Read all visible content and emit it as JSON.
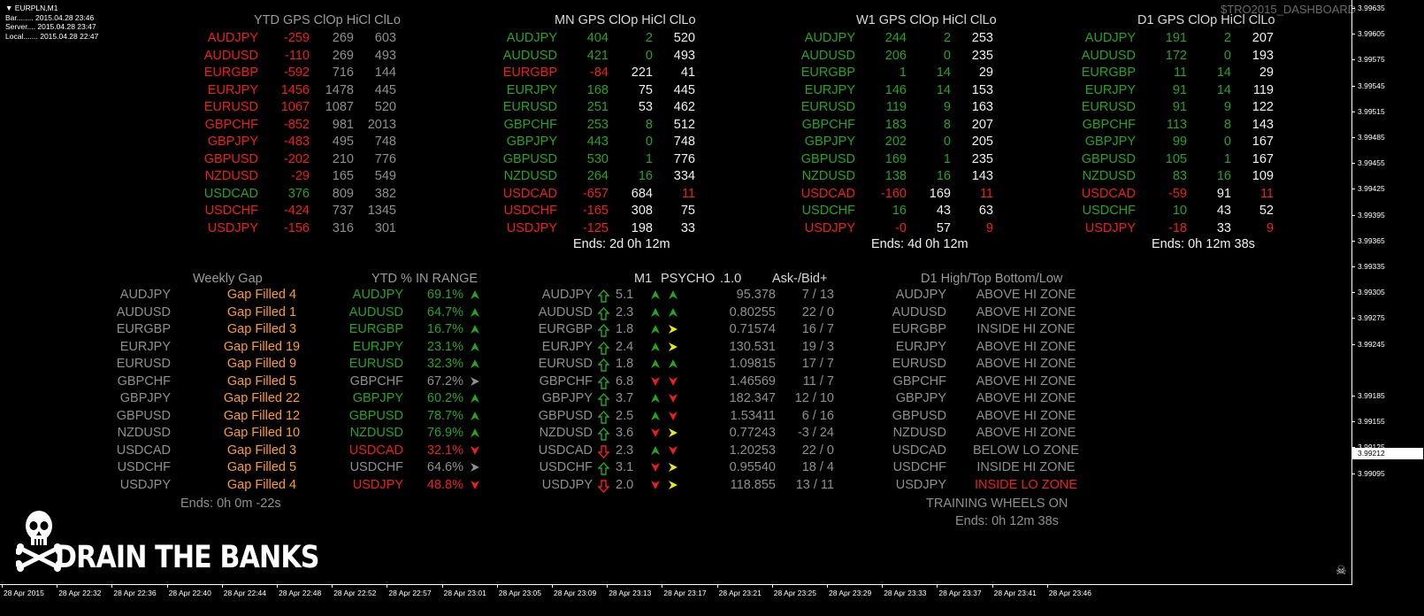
{
  "window": {
    "title": "EURPLN,M1",
    "bar_label": "Bar........ 2015.04.28 23:46",
    "server_label": "Server.... 2015.04.28 23:47",
    "local_label": "Local....... 2015.04.28 22:47",
    "watermark": "$TRO2015_DASHBOARD"
  },
  "gps_panels": [
    {
      "title": "YTD GPS ClOp HiCl ClLo",
      "ends": "",
      "rows": [
        {
          "sym": "AUDJPY",
          "sc": "r",
          "gps": "-259",
          "gc": "r",
          "a": "269",
          "ac": "gr",
          "b": "603",
          "bc": "gr"
        },
        {
          "sym": "AUDUSD",
          "sc": "r",
          "gps": "-110",
          "gc": "r",
          "a": "269",
          "ac": "gr",
          "b": "493",
          "bc": "gr"
        },
        {
          "sym": "EURGBP",
          "sc": "r",
          "gps": "-592",
          "gc": "r",
          "a": "716",
          "ac": "gr",
          "b": "144",
          "bc": "gr"
        },
        {
          "sym": "EURJPY",
          "sc": "r",
          "gps": "1456",
          "gc": "r",
          "a": "1478",
          "ac": "gr",
          "b": "445",
          "bc": "gr"
        },
        {
          "sym": "EURUSD",
          "sc": "r",
          "gps": "1067",
          "gc": "r",
          "a": "1087",
          "ac": "gr",
          "b": "520",
          "bc": "gr"
        },
        {
          "sym": "GBPCHF",
          "sc": "r",
          "gps": "-852",
          "gc": "r",
          "a": "981",
          "ac": "gr",
          "b": "2013",
          "bc": "gr"
        },
        {
          "sym": "GBPJPY",
          "sc": "r",
          "gps": "-483",
          "gc": "r",
          "a": "495",
          "ac": "gr",
          "b": "748",
          "bc": "gr"
        },
        {
          "sym": "GBPUSD",
          "sc": "r",
          "gps": "-202",
          "gc": "r",
          "a": "210",
          "ac": "gr",
          "b": "776",
          "bc": "gr"
        },
        {
          "sym": "NZDUSD",
          "sc": "r",
          "gps": "-29",
          "gc": "r",
          "a": "165",
          "ac": "gr",
          "b": "549",
          "bc": "gr"
        },
        {
          "sym": "USDCAD",
          "sc": "g",
          "gps": "376",
          "gc": "g",
          "a": "809",
          "ac": "gr",
          "b": "382",
          "bc": "gr"
        },
        {
          "sym": "USDCHF",
          "sc": "r",
          "gps": "-424",
          "gc": "r",
          "a": "737",
          "ac": "gr",
          "b": "1345",
          "bc": "gr"
        },
        {
          "sym": "USDJPY",
          "sc": "r",
          "gps": "-156",
          "gc": "r",
          "a": "316",
          "ac": "gr",
          "b": "301",
          "bc": "gr"
        }
      ]
    },
    {
      "title": "MN GPS  ClOp HiCl ClLo",
      "ends": "Ends: 2d 0h 12m",
      "rows": [
        {
          "sym": "AUDJPY",
          "sc": "g",
          "gps": "404",
          "gc": "g",
          "a": "2",
          "ac": "g",
          "b": "520",
          "bc": "w"
        },
        {
          "sym": "AUDUSD",
          "sc": "g",
          "gps": "421",
          "gc": "g",
          "a": "0",
          "ac": "g",
          "b": "493",
          "bc": "w"
        },
        {
          "sym": "EURGBP",
          "sc": "r",
          "gps": "-84",
          "gc": "r",
          "a": "221",
          "ac": "w",
          "b": "41",
          "bc": "w"
        },
        {
          "sym": "EURJPY",
          "sc": "g",
          "gps": "168",
          "gc": "g",
          "a": "75",
          "ac": "w",
          "b": "445",
          "bc": "w"
        },
        {
          "sym": "EURUSD",
          "sc": "g",
          "gps": "251",
          "gc": "g",
          "a": "53",
          "ac": "w",
          "b": "462",
          "bc": "w"
        },
        {
          "sym": "GBPCHF",
          "sc": "g",
          "gps": "253",
          "gc": "g",
          "a": "8",
          "ac": "g",
          "b": "512",
          "bc": "w"
        },
        {
          "sym": "GBPJPY",
          "sc": "g",
          "gps": "443",
          "gc": "g",
          "a": "0",
          "ac": "g",
          "b": "748",
          "bc": "w"
        },
        {
          "sym": "GBPUSD",
          "sc": "g",
          "gps": "530",
          "gc": "g",
          "a": "1",
          "ac": "g",
          "b": "776",
          "bc": "w"
        },
        {
          "sym": "NZDUSD",
          "sc": "g",
          "gps": "264",
          "gc": "g",
          "a": "16",
          "ac": "g",
          "b": "334",
          "bc": "w"
        },
        {
          "sym": "USDCAD",
          "sc": "r",
          "gps": "-657",
          "gc": "r",
          "a": "684",
          "ac": "w",
          "b": "11",
          "bc": "r"
        },
        {
          "sym": "USDCHF",
          "sc": "r",
          "gps": "-165",
          "gc": "r",
          "a": "308",
          "ac": "w",
          "b": "75",
          "bc": "w"
        },
        {
          "sym": "USDJPY",
          "sc": "r",
          "gps": "-125",
          "gc": "r",
          "a": "198",
          "ac": "w",
          "b": "33",
          "bc": "w"
        }
      ]
    },
    {
      "title": "W1 GPS  ClOp HiCl ClLo",
      "ends": "Ends: 4d 0h 12m",
      "rows": [
        {
          "sym": "AUDJPY",
          "sc": "g",
          "gps": "244",
          "gc": "g",
          "a": "2",
          "ac": "g",
          "b": "253",
          "bc": "w"
        },
        {
          "sym": "AUDUSD",
          "sc": "g",
          "gps": "206",
          "gc": "g",
          "a": "0",
          "ac": "g",
          "b": "235",
          "bc": "w"
        },
        {
          "sym": "EURGBP",
          "sc": "g",
          "gps": "1",
          "gc": "g",
          "a": "14",
          "ac": "g",
          "b": "29",
          "bc": "w"
        },
        {
          "sym": "EURJPY",
          "sc": "g",
          "gps": "146",
          "gc": "g",
          "a": "14",
          "ac": "g",
          "b": "153",
          "bc": "w"
        },
        {
          "sym": "EURUSD",
          "sc": "g",
          "gps": "119",
          "gc": "g",
          "a": "9",
          "ac": "g",
          "b": "163",
          "bc": "w"
        },
        {
          "sym": "GBPCHF",
          "sc": "g",
          "gps": "183",
          "gc": "g",
          "a": "8",
          "ac": "g",
          "b": "207",
          "bc": "w"
        },
        {
          "sym": "GBPJPY",
          "sc": "g",
          "gps": "202",
          "gc": "g",
          "a": "0",
          "ac": "g",
          "b": "205",
          "bc": "w"
        },
        {
          "sym": "GBPUSD",
          "sc": "g",
          "gps": "169",
          "gc": "g",
          "a": "1",
          "ac": "g",
          "b": "235",
          "bc": "w"
        },
        {
          "sym": "NZDUSD",
          "sc": "g",
          "gps": "138",
          "gc": "g",
          "a": "16",
          "ac": "g",
          "b": "143",
          "bc": "w"
        },
        {
          "sym": "USDCAD",
          "sc": "r",
          "gps": "-160",
          "gc": "r",
          "a": "169",
          "ac": "w",
          "b": "11",
          "bc": "r"
        },
        {
          "sym": "USDCHF",
          "sc": "g",
          "gps": "16",
          "gc": "g",
          "a": "43",
          "ac": "w",
          "b": "63",
          "bc": "w"
        },
        {
          "sym": "USDJPY",
          "sc": "r",
          "gps": "-0",
          "gc": "r",
          "a": "57",
          "ac": "w",
          "b": "9",
          "bc": "r"
        }
      ]
    },
    {
      "title": "D1 GPS  ClOp HiCl ClLo",
      "ends": "Ends: 0h 12m 38s",
      "rows": [
        {
          "sym": "AUDJPY",
          "sc": "g",
          "gps": "191",
          "gc": "g",
          "a": "2",
          "ac": "g",
          "b": "207",
          "bc": "w"
        },
        {
          "sym": "AUDUSD",
          "sc": "g",
          "gps": "172",
          "gc": "g",
          "a": "0",
          "ac": "g",
          "b": "193",
          "bc": "w"
        },
        {
          "sym": "EURGBP",
          "sc": "g",
          "gps": "11",
          "gc": "g",
          "a": "14",
          "ac": "g",
          "b": "29",
          "bc": "w"
        },
        {
          "sym": "EURJPY",
          "sc": "g",
          "gps": "91",
          "gc": "g",
          "a": "14",
          "ac": "g",
          "b": "119",
          "bc": "w"
        },
        {
          "sym": "EURUSD",
          "sc": "g",
          "gps": "91",
          "gc": "g",
          "a": "9",
          "ac": "g",
          "b": "122",
          "bc": "w"
        },
        {
          "sym": "GBPCHF",
          "sc": "g",
          "gps": "113",
          "gc": "g",
          "a": "8",
          "ac": "g",
          "b": "143",
          "bc": "w"
        },
        {
          "sym": "GBPJPY",
          "sc": "g",
          "gps": "99",
          "gc": "g",
          "a": "0",
          "ac": "g",
          "b": "167",
          "bc": "w"
        },
        {
          "sym": "GBPUSD",
          "sc": "g",
          "gps": "105",
          "gc": "g",
          "a": "1",
          "ac": "g",
          "b": "167",
          "bc": "w"
        },
        {
          "sym": "NZDUSD",
          "sc": "g",
          "gps": "83",
          "gc": "g",
          "a": "16",
          "ac": "g",
          "b": "109",
          "bc": "w"
        },
        {
          "sym": "USDCAD",
          "sc": "r",
          "gps": "-59",
          "gc": "r",
          "a": "91",
          "ac": "w",
          "b": "11",
          "bc": "r"
        },
        {
          "sym": "USDCHF",
          "sc": "g",
          "gps": "10",
          "gc": "g",
          "a": "43",
          "ac": "w",
          "b": "52",
          "bc": "w"
        },
        {
          "sym": "USDJPY",
          "sc": "r",
          "gps": "-18",
          "gc": "r",
          "a": "33",
          "ac": "w",
          "b": "9",
          "bc": "r"
        }
      ]
    }
  ],
  "weekly_gap": {
    "title": "Weekly Gap",
    "ends": "Ends: 0h 0m -22s",
    "rows": [
      {
        "sym": "AUDJPY",
        "val": "Gap Filled 4"
      },
      {
        "sym": "AUDUSD",
        "val": "Gap Filled 1"
      },
      {
        "sym": "EURGBP",
        "val": "Gap Filled 3"
      },
      {
        "sym": "EURJPY",
        "val": "Gap Filled 19"
      },
      {
        "sym": "EURUSD",
        "val": "Gap Filled 9"
      },
      {
        "sym": "GBPCHF",
        "val": "Gap Filled 5"
      },
      {
        "sym": "GBPJPY",
        "val": "Gap Filled 22"
      },
      {
        "sym": "GBPUSD",
        "val": "Gap Filled 12"
      },
      {
        "sym": "NZDUSD",
        "val": "Gap Filled 10"
      },
      {
        "sym": "USDCAD",
        "val": "Gap Filled 3"
      },
      {
        "sym": "USDCHF",
        "val": "Gap Filled 5"
      },
      {
        "sym": "USDJPY",
        "val": "Gap Filled 4"
      }
    ]
  },
  "ytd_range": {
    "title": "YTD % IN RANGE",
    "rows": [
      {
        "sym": "AUDJPY",
        "pct": "69.1%",
        "c": "g",
        "arrow": "up",
        "ac": "g"
      },
      {
        "sym": "AUDUSD",
        "pct": "64.7%",
        "c": "g",
        "arrow": "up",
        "ac": "g"
      },
      {
        "sym": "EURGBP",
        "pct": "16.7%",
        "c": "g",
        "arrow": "up",
        "ac": "g"
      },
      {
        "sym": "EURJPY",
        "pct": "23.1%",
        "c": "g",
        "arrow": "up",
        "ac": "g"
      },
      {
        "sym": "EURUSD",
        "pct": "32.3%",
        "c": "g",
        "arrow": "up",
        "ac": "g"
      },
      {
        "sym": "GBPCHF",
        "pct": "67.2%",
        "c": "gr",
        "arrow": "right",
        "ac": "gr"
      },
      {
        "sym": "GBPJPY",
        "pct": "60.2%",
        "c": "g",
        "arrow": "up",
        "ac": "g"
      },
      {
        "sym": "GBPUSD",
        "pct": "78.7%",
        "c": "g",
        "arrow": "up",
        "ac": "g"
      },
      {
        "sym": "NZDUSD",
        "pct": "76.9%",
        "c": "g",
        "arrow": "up",
        "ac": "g"
      },
      {
        "sym": "USDCAD",
        "pct": "32.1%",
        "c": "r",
        "arrow": "down",
        "ac": "r"
      },
      {
        "sym": "USDCHF",
        "pct": "64.6%",
        "c": "gr",
        "arrow": "right",
        "ac": "gr"
      },
      {
        "sym": "USDJPY",
        "pct": "48.8%",
        "c": "r",
        "arrow": "down",
        "ac": "r"
      }
    ]
  },
  "psycho": {
    "title_m1": "M1",
    "title_psycho": "PSYCHO",
    "title_10": ".1.0",
    "title_askbid": "Ask-/Bid+",
    "rows": [
      {
        "sym": "AUDJPY",
        "dir": "up",
        "val": "5.1",
        "a1": "up",
        "a1c": "g",
        "a2": "up",
        "a2c": "g",
        "price": "95.378",
        "ab": "7 / 13"
      },
      {
        "sym": "AUDUSD",
        "dir": "up",
        "val": "2.3",
        "a1": "up",
        "a1c": "g",
        "a2": "up",
        "a2c": "g",
        "price": "0.80255",
        "ab": "22 /  0"
      },
      {
        "sym": "EURGBP",
        "dir": "up",
        "val": "1.8",
        "a1": "up",
        "a1c": "g",
        "a2": "right",
        "a2c": "y",
        "price": "0.71574",
        "ab": "16 /  7"
      },
      {
        "sym": "EURJPY",
        "dir": "up",
        "val": "2.4",
        "a1": "up",
        "a1c": "g",
        "a2": "right",
        "a2c": "y",
        "price": "130.531",
        "ab": "19 /  3"
      },
      {
        "sym": "EURUSD",
        "dir": "up",
        "val": "1.8",
        "a1": "up",
        "a1c": "g",
        "a2": "up",
        "a2c": "g",
        "price": "1.09815",
        "ab": "17 /  7"
      },
      {
        "sym": "GBPCHF",
        "dir": "up",
        "val": "6.8",
        "a1": "down",
        "a1c": "r",
        "a2": "down",
        "a2c": "r",
        "price": "1.46569",
        "ab": "11 /  7"
      },
      {
        "sym": "GBPJPY",
        "dir": "up",
        "val": "3.7",
        "a1": "up",
        "a1c": "g",
        "a2": "down",
        "a2c": "r",
        "price": "182.347",
        "ab": "12 / 10"
      },
      {
        "sym": "GBPUSD",
        "dir": "up",
        "val": "2.5",
        "a1": "up",
        "a1c": "g",
        "a2": "down",
        "a2c": "r",
        "price": "1.53411",
        "ab": "6 / 16"
      },
      {
        "sym": "NZDUSD",
        "dir": "up",
        "val": "3.6",
        "a1": "down",
        "a1c": "r",
        "a2": "right",
        "a2c": "y",
        "price": "0.77243",
        "ab": "-3 / 24"
      },
      {
        "sym": "USDCAD",
        "dir": "down",
        "val": "2.3",
        "a1": "up",
        "a1c": "g",
        "a2": "down",
        "a2c": "r",
        "price": "1.20253",
        "ab": "22 /  0"
      },
      {
        "sym": "USDCHF",
        "dir": "up",
        "val": "3.1",
        "a1": "down",
        "a1c": "r",
        "a2": "right",
        "a2c": "y",
        "price": "0.95540",
        "ab": "18 /  4"
      },
      {
        "sym": "USDJPY",
        "dir": "down",
        "val": "2.0",
        "a1": "down",
        "a1c": "r",
        "a2": "right",
        "a2c": "y",
        "price": "118.855",
        "ab": "13 / 11"
      }
    ]
  },
  "d1_zone": {
    "title": "D1 High/Top Bottom/Low",
    "footer1": "TRAINING WHEELS ON",
    "footer2": "Ends: 0h 12m 38s",
    "rows": [
      {
        "sym": "AUDJPY",
        "zone": "ABOVE HI ZONE",
        "c": "gr"
      },
      {
        "sym": "AUDUSD",
        "zone": "ABOVE HI ZONE",
        "c": "gr"
      },
      {
        "sym": "EURGBP",
        "zone": "INSIDE HI ZONE",
        "c": "gr"
      },
      {
        "sym": "EURJPY",
        "zone": "ABOVE HI ZONE",
        "c": "gr"
      },
      {
        "sym": "EURUSD",
        "zone": "ABOVE HI ZONE",
        "c": "gr"
      },
      {
        "sym": "GBPCHF",
        "zone": "ABOVE HI ZONE",
        "c": "gr"
      },
      {
        "sym": "GBPJPY",
        "zone": "ABOVE HI ZONE",
        "c": "gr"
      },
      {
        "sym": "GBPUSD",
        "zone": "ABOVE HI ZONE",
        "c": "gr"
      },
      {
        "sym": "NZDUSD",
        "zone": "ABOVE HI ZONE",
        "c": "gr"
      },
      {
        "sym": "USDCAD",
        "zone": "BELOW LO ZONE",
        "c": "gr"
      },
      {
        "sym": "USDCHF",
        "zone": "INSIDE HI ZONE",
        "c": "gr"
      },
      {
        "sym": "USDJPY",
        "zone": "INSIDE LO ZONE",
        "c": "r"
      }
    ]
  },
  "logo_text": "DRAIN THE BANKS",
  "price_axis": [
    "3.99635",
    "3.99605",
    "3.99575",
    "3.99545",
    "3.99515",
    "3.99485",
    "3.99455",
    "3.99425",
    "3.99395",
    "3.99365",
    "3.99335",
    "3.99305",
    "3.99275",
    "3.99245",
    "3.99212",
    "3.99185",
    "3.99155",
    "3.99125",
    "3.99095"
  ],
  "current_price": "3.99212",
  "time_axis": [
    "28 Apr 2015",
    "28 Apr 22:32",
    "28 Apr 22:36",
    "28 Apr 22:40",
    "28 Apr 22:44",
    "28 Apr 22:48",
    "28 Apr 22:52",
    "28 Apr 22:57",
    "28 Apr 23:01",
    "28 Apr 23:05",
    "28 Apr 23:09",
    "28 Apr 23:13",
    "28 Apr 23:17",
    "28 Apr 23:21",
    "28 Apr 23:25",
    "28 Apr 23:29",
    "28 Apr 23:33",
    "28 Apr 23:37",
    "28 Apr 23:41",
    "28 Apr 23:46"
  ],
  "colors": {
    "green": "#22a51f",
    "red": "#f01d1d",
    "gray": "#8f8f8f",
    "orange": "#ff9c1c",
    "yellow": "#e8e81a",
    "background": "#000000"
  }
}
